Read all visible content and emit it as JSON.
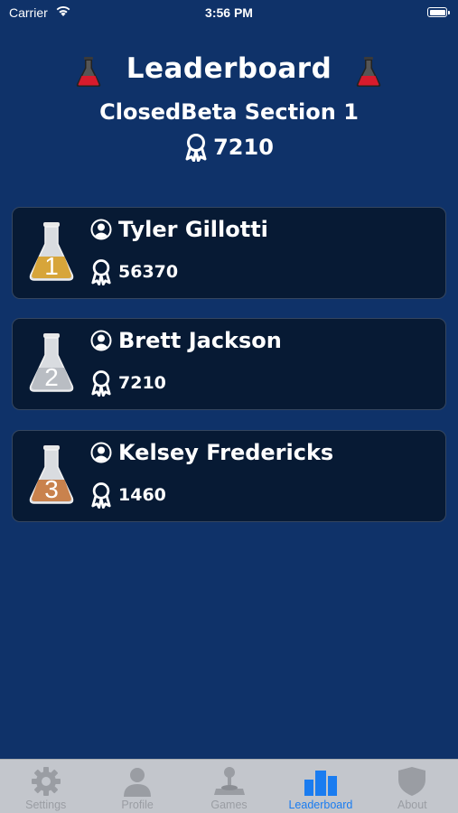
{
  "status_bar": {
    "carrier": "Carrier",
    "time": "3:56 PM"
  },
  "header": {
    "title": "Leaderboard",
    "section": "ClosedBeta Section 1",
    "points": "7210"
  },
  "leaderboard": [
    {
      "rank": "1",
      "name": "Tyler Gillotti",
      "score": "56370",
      "flask_color": "#d7a53a"
    },
    {
      "rank": "2",
      "name": "Brett Jackson",
      "score": "7210",
      "flask_color": "#b9bdc3"
    },
    {
      "rank": "3",
      "name": "Kelsey Fredericks",
      "score": "1460",
      "flask_color": "#c9824d"
    }
  ],
  "tab_bar": {
    "items": [
      {
        "label": "Settings",
        "icon": "gear-icon"
      },
      {
        "label": "Profile",
        "icon": "person-icon"
      },
      {
        "label": "Games",
        "icon": "joystick-icon"
      },
      {
        "label": "Leaderboard",
        "icon": "podium-icon"
      },
      {
        "label": "About",
        "icon": "shield-icon"
      }
    ],
    "active_index": 3
  },
  "colors": {
    "background": "#0f3269",
    "card_background": "#071a34",
    "tab_active": "#1a7cf0",
    "tab_inactive": "#9a9da3",
    "title_flask": "#d81b2c"
  }
}
